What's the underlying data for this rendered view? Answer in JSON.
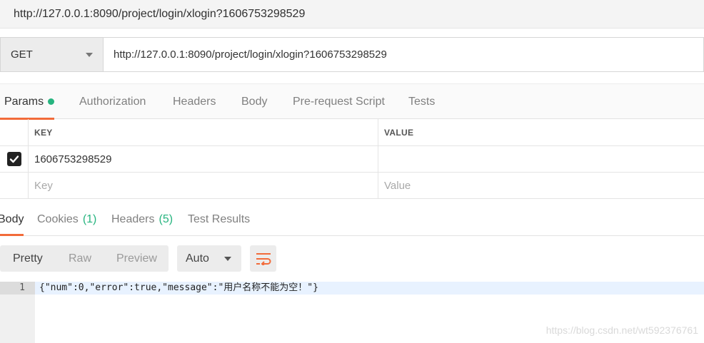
{
  "window": {
    "title": "http://127.0.0.1:8090/project/login/xlogin?1606753298529"
  },
  "request": {
    "method": "GET",
    "url": "http://127.0.0.1:8090/project/login/xlogin?1606753298529"
  },
  "request_tabs": [
    {
      "label": "Params",
      "active": true,
      "has_dot": true
    },
    {
      "label": "Authorization"
    },
    {
      "label": "Headers"
    },
    {
      "label": "Body"
    },
    {
      "label": "Pre-request Script"
    },
    {
      "label": "Tests"
    }
  ],
  "params": {
    "header_key": "KEY",
    "header_value": "VALUE",
    "rows": [
      {
        "checked": true,
        "key": "1606753298529",
        "value": ""
      }
    ],
    "placeholder_key": "Key",
    "placeholder_value": "Value"
  },
  "response_tabs": [
    {
      "label": "Body",
      "active": true
    },
    {
      "label": "Cookies",
      "count": "(1)"
    },
    {
      "label": "Headers",
      "count": "(5)"
    },
    {
      "label": "Test Results"
    }
  ],
  "view_modes": [
    "Pretty",
    "Raw",
    "Preview"
  ],
  "format": "Auto",
  "response_body": {
    "line_number": "1",
    "text": "{\"num\":0,\"error\":true,\"message\":\"用户名称不能为空！\"}"
  },
  "watermark": "https://blog.csdn.net/wt592376761",
  "colors": {
    "accent": "#f26b3a",
    "success": "#26b47f"
  },
  "icons": {
    "method_dropdown": "chevron-down-icon",
    "checkbox": "check-icon",
    "wrap": "wrap-lines-icon"
  }
}
